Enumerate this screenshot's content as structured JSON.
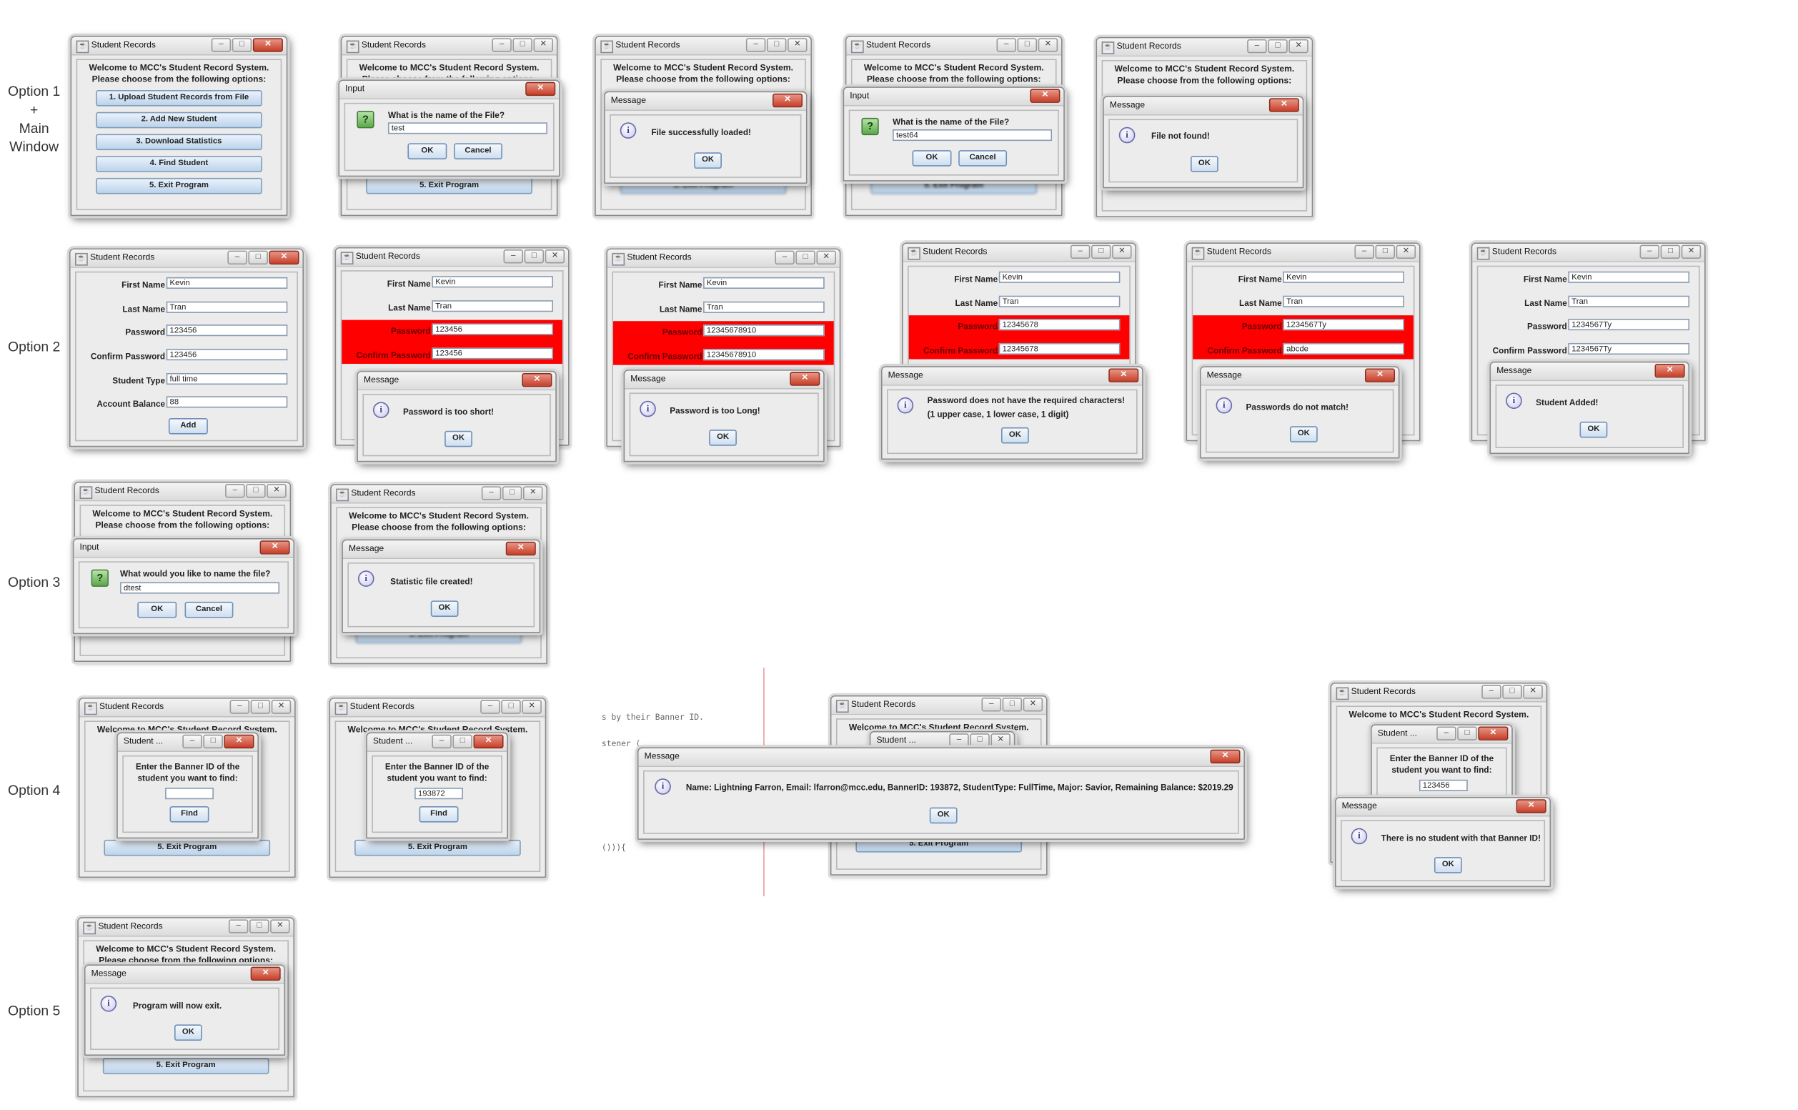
{
  "row_labels": [
    "Option 1\n+\nMain\nWindow",
    "Option 2",
    "Option 3",
    "Option 4",
    "Option 5"
  ],
  "title_student": "Student Records",
  "title_input": "Input",
  "title_message": "Message",
  "title_student_short": "Student ...",
  "welcome_line1": "Welcome to MCC's Student Record System.",
  "welcome_line2": "Please choose from the following options:",
  "menu": [
    "1. Upload Student Records from File",
    "2. Add New Student",
    "3. Download Statistics",
    "4. Find Student",
    "5. Exit Program"
  ],
  "ok": "OK",
  "cancel": "Cancel",
  "add": "Add",
  "find": "Find",
  "prompt_file": "What is the name of the File?",
  "prompt_stats": "What would you like to name the file?",
  "prompt_banner_1": "Enter the Banner ID of the",
  "prompt_banner_2": "student you want to find:",
  "file_input_1": "test",
  "file_input_2": "test64",
  "stats_input": "dtest",
  "banner_input_1": "",
  "banner_input_2": "193872",
  "banner_input_3": "123456",
  "msg_loaded": "File successfully loaded!",
  "msg_notfound": "File not found!",
  "msg_short": "Password is too short!",
  "msg_long": "Password is too Long!",
  "msg_chars_1": "Password does not have the required characters!",
  "msg_chars_2": "(1 upper case, 1 lower case, 1 digit)",
  "msg_nomatch": "Passwords do not match!",
  "msg_added": "Student Added!",
  "msg_stats": "Statistic file created!",
  "msg_found": "Name: Lightning Farron, Email: lfarron@mcc.edu, BannerID: 193872, StudentType: FullTime, Major: Savior, Remaining Balance: $2019.29",
  "msg_nostudent": "There is no student with that Banner ID!",
  "msg_exit": "Program will now exit.",
  "labels": {
    "first": "First Name",
    "last": "Last Name",
    "password": "Password",
    "confirm": "Confirm Password",
    "type": "Student Type",
    "balance": "Account Balance"
  },
  "form": {
    "first": "Kevin",
    "last": "Tran",
    "p1": "123456",
    "c1": "123456",
    "type": "full time",
    "balance": "88",
    "p_long": "12345678910",
    "p_chars": "12345678",
    "p_nomatch": "1234567Ty",
    "c_nomatch": "abcde",
    "p_ok": "1234567Ty"
  },
  "code_lines": [
    "s by their Banner ID.",
    "stener (",
    "())){"
  ]
}
